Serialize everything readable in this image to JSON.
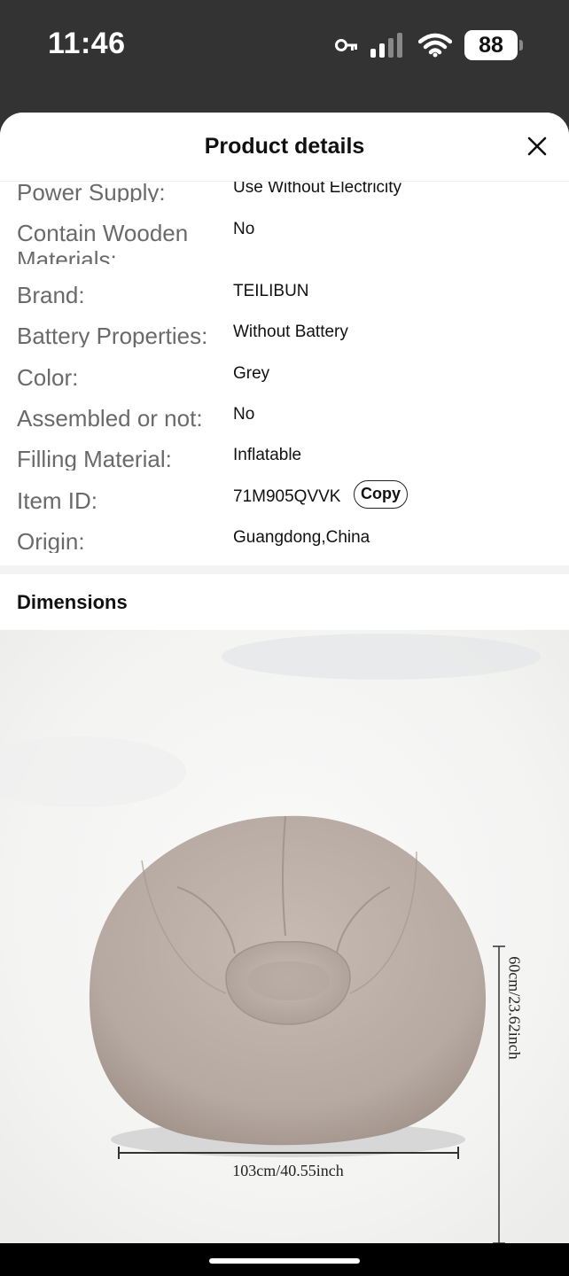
{
  "status_bar": {
    "time": "11:46",
    "battery": "88",
    "icons": [
      "vpn-key-icon",
      "cellular-signal-icon",
      "wifi-icon",
      "battery-icon"
    ]
  },
  "sheet": {
    "title": "Product details",
    "close_icon": "close-icon"
  },
  "specs": [
    {
      "label": "Power Supply:",
      "value": "Use Without Electricity"
    },
    {
      "label": "Contain Wooden Materials:",
      "value": "No"
    },
    {
      "label": "Brand:",
      "value": "TEILIBUN"
    },
    {
      "label": "Battery Properties:",
      "value": "Without Battery"
    },
    {
      "label": "Color:",
      "value": "Grey"
    },
    {
      "label": "Assembled or not:",
      "value": "No"
    },
    {
      "label": "Filling Material:",
      "value": "Inflatable"
    },
    {
      "label": "Item ID:",
      "value": "71M905QVVK"
    },
    {
      "label": "Origin:",
      "value": "Guangdong,China"
    }
  ],
  "copy_label": "Copy",
  "dimensions": {
    "title": "Dimensions",
    "width_label": "103cm/40.55inch",
    "height_label": "60cm/23.62inch"
  },
  "colors": {
    "chair": "#b8aba3",
    "background_dark": "#333333"
  }
}
